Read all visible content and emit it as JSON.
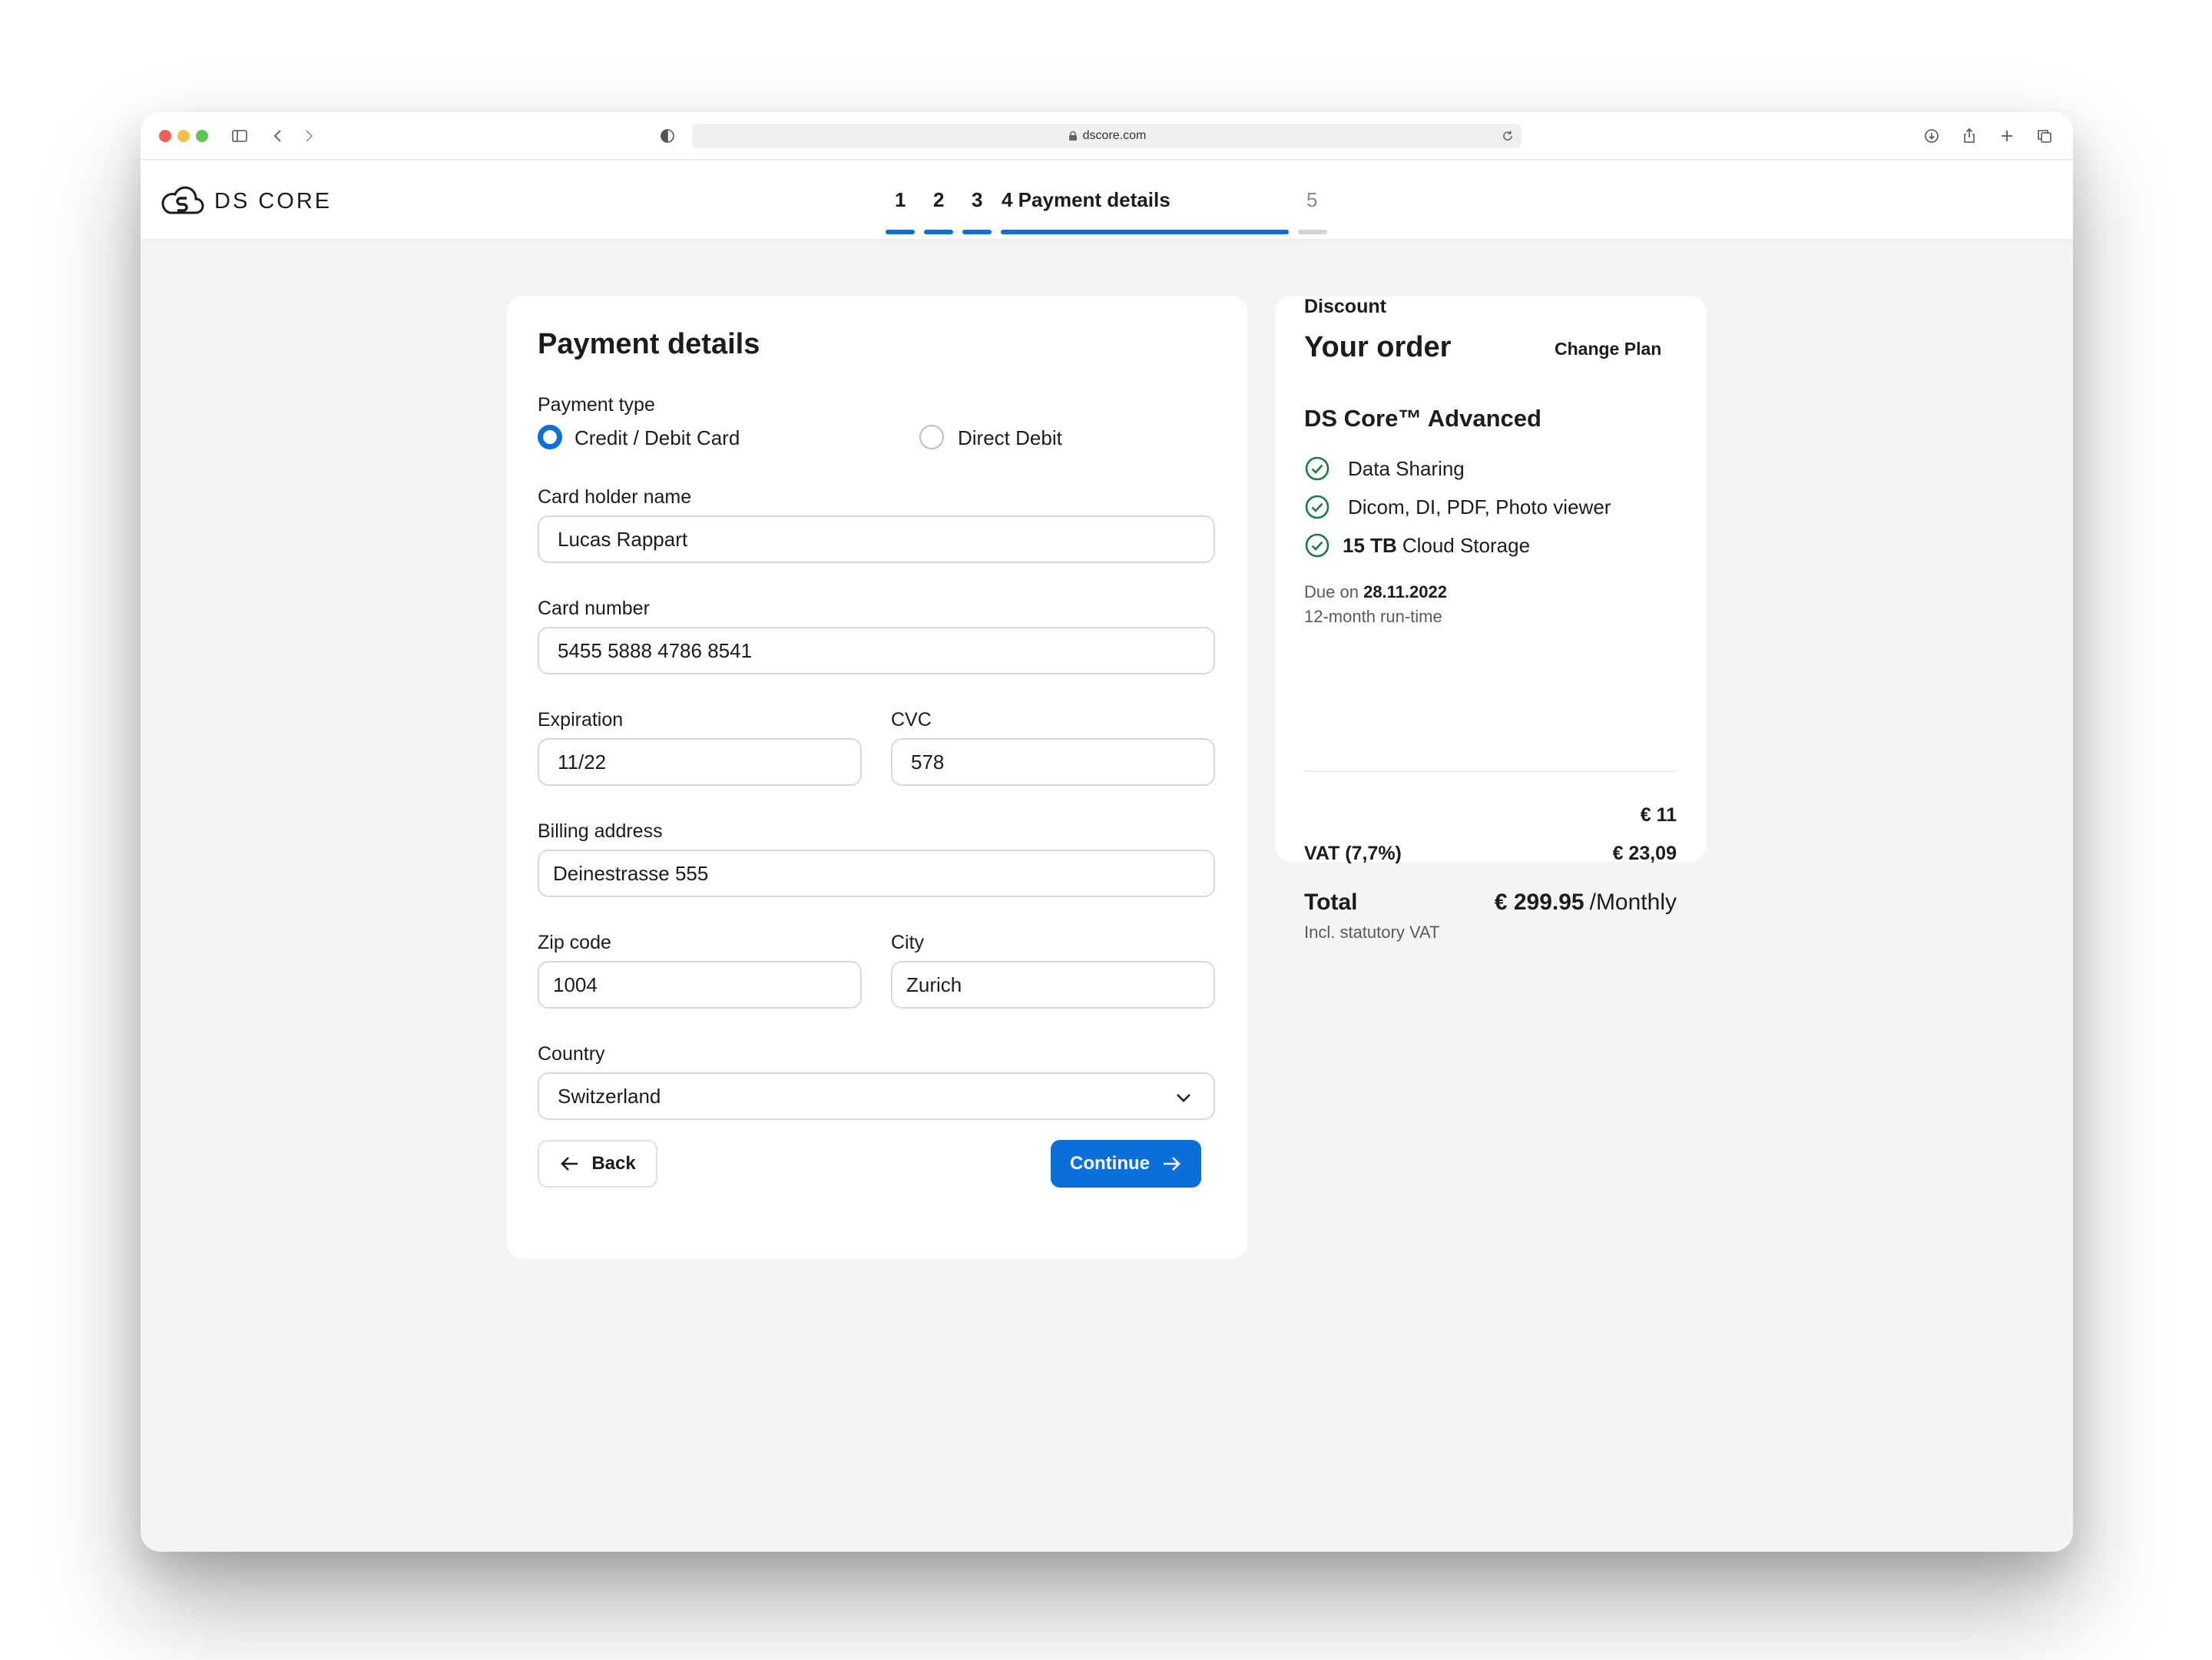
{
  "browser": {
    "url": "dscore.com"
  },
  "header": {
    "logo_text": "DS CORE",
    "steps": [
      {
        "label": "1",
        "state": "done"
      },
      {
        "label": "2",
        "state": "done"
      },
      {
        "label": "3",
        "state": "done"
      },
      {
        "label": "4 Payment details",
        "state": "current"
      },
      {
        "label": "5",
        "state": "upcoming"
      }
    ]
  },
  "payment": {
    "title": "Payment details",
    "payment_type_label": "Payment type",
    "options": [
      {
        "label": "Credit / Debit Card",
        "selected": true
      },
      {
        "label": "Direct Debit",
        "selected": false
      }
    ],
    "card_holder": {
      "label": "Card holder name",
      "value": "Lucas Rappart"
    },
    "card_number": {
      "label": "Card number",
      "value": "5455 5888 4786 8541"
    },
    "expiration": {
      "label": "Expiration",
      "value": "11/22"
    },
    "cvc": {
      "label": "CVC",
      "value": "578"
    },
    "billing_address": {
      "label": "Billing address",
      "value": "Deinestrasse 555"
    },
    "zip": {
      "label": "Zip code",
      "value": "1004"
    },
    "city": {
      "label": "City",
      "value": "Zurich"
    },
    "country": {
      "label": "Country",
      "value": "Switzerland"
    },
    "back_label": "Back",
    "continue_label": "Continue"
  },
  "order": {
    "title": "Your order",
    "change_plan": "Change Plan",
    "plan_name": "DS Core™ Advanced",
    "features": [
      {
        "bold": "",
        "text": "Data Sharing"
      },
      {
        "bold": "",
        "text": "Dicom, DI, PDF, Photo viewer"
      },
      {
        "bold": "15 TB",
        "text": "Cloud Storage"
      }
    ],
    "due_prefix": "Due on",
    "due_date": "28.11.2022",
    "runtime": "12-month run-time",
    "discount_label": "Discount",
    "discount_value": "€ 11",
    "vat_label": "VAT (7,7%)",
    "vat_value": "€ 23,09",
    "total_label": "Total",
    "total_value": "€ 299.95",
    "total_period": "/Monthly",
    "total_note": "Incl. statutory VAT"
  },
  "colors": {
    "accent": "#0a6fd8",
    "check": "#1e7a45"
  }
}
